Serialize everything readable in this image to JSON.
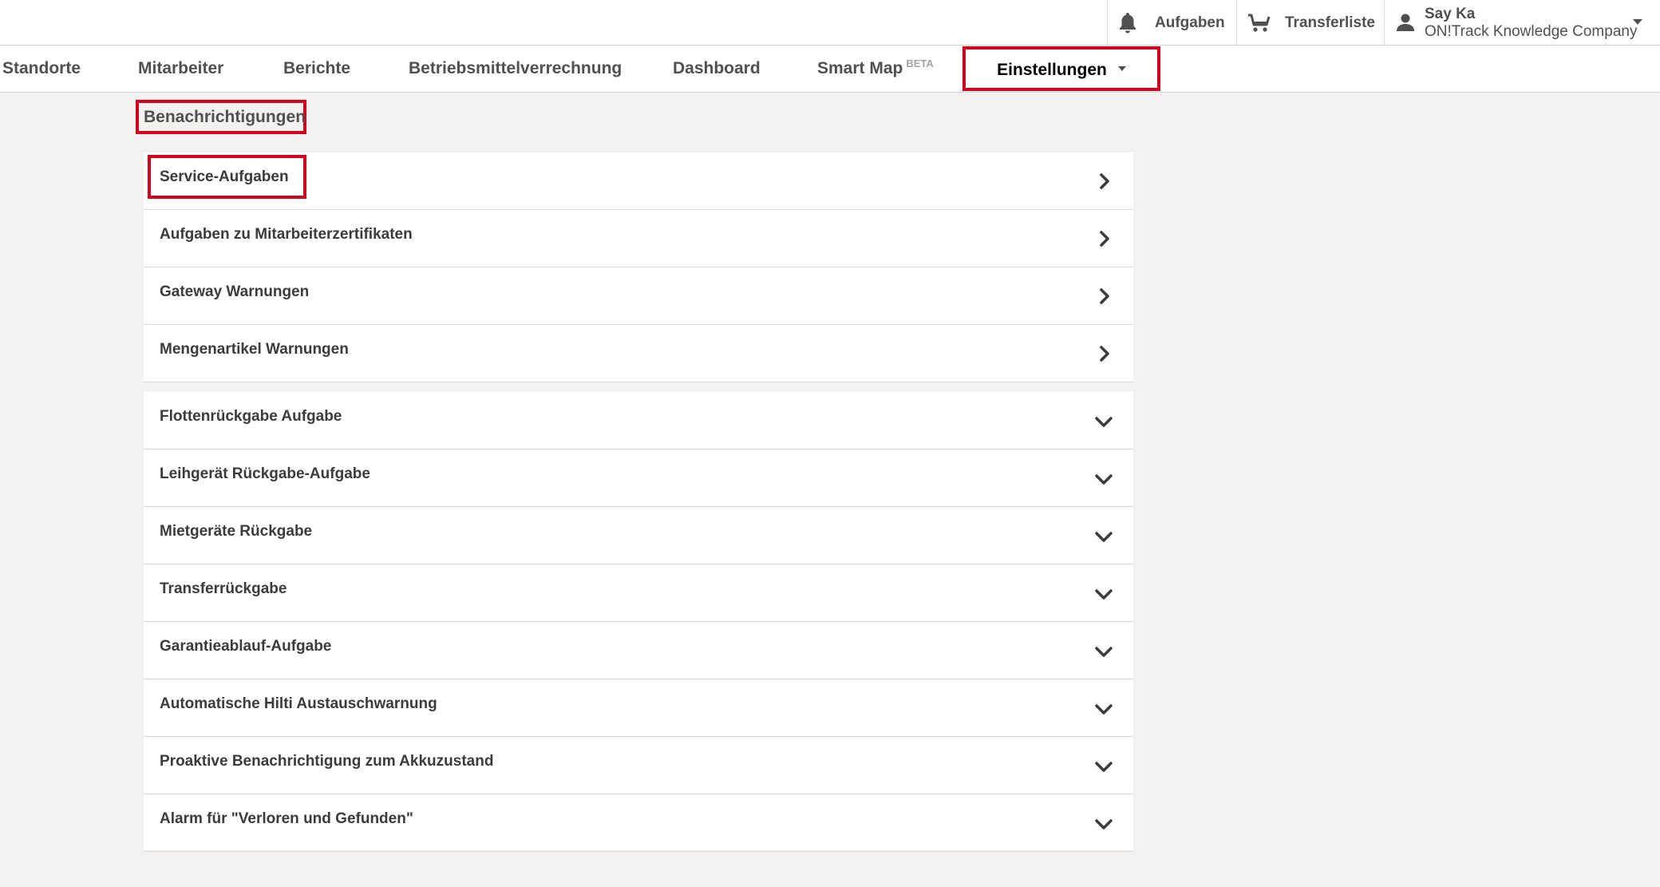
{
  "topbar": {
    "tasks_label": "Aufgaben",
    "transfer_label": "Transferliste",
    "user_name": "Say Ka",
    "company": "ON!Track Knowledge Company"
  },
  "nav": {
    "items": [
      {
        "label": "Standorte"
      },
      {
        "label": "Mitarbeiter"
      },
      {
        "label": "Berichte"
      },
      {
        "label": "Betriebsmittelverrechnung"
      },
      {
        "label": "Dashboard"
      },
      {
        "label": "Smart Map",
        "badge": "BETA"
      },
      {
        "label": "Einstellungen",
        "active": true
      }
    ]
  },
  "section": {
    "title": "Benachrichtigungen"
  },
  "list_a": [
    {
      "label": "Service-Aufgaben",
      "icon": "chevron-right-icon"
    },
    {
      "label": "Aufgaben zu Mitarbeiterzertifikaten",
      "icon": "chevron-right-icon"
    },
    {
      "label": "Gateway Warnungen",
      "icon": "chevron-right-icon"
    },
    {
      "label": "Mengenartikel Warnungen",
      "icon": "chevron-right-icon"
    }
  ],
  "list_b": [
    {
      "label": "Flottenrückgabe Aufgabe",
      "icon": "chevron-down-icon"
    },
    {
      "label": "Leihgerät Rückgabe-Aufgabe",
      "icon": "chevron-down-icon"
    },
    {
      "label": "Mietgeräte Rückgabe",
      "icon": "chevron-down-icon"
    },
    {
      "label": "Transferrückgabe",
      "icon": "chevron-down-icon"
    },
    {
      "label": "Garantieablauf-Aufgabe",
      "icon": "chevron-down-icon"
    },
    {
      "label": "Automatische Hilti Austauschwarnung",
      "icon": "chevron-down-icon"
    },
    {
      "label": "Proaktive Benachrichtigung zum Akkuzustand",
      "icon": "chevron-down-icon"
    },
    {
      "label": "Alarm für \"Verloren und Gefunden\"",
      "icon": "chevron-down-icon"
    }
  ],
  "colors": {
    "highlight": "#d2051e",
    "background": "#f3f2f0",
    "text": "#524f53"
  }
}
